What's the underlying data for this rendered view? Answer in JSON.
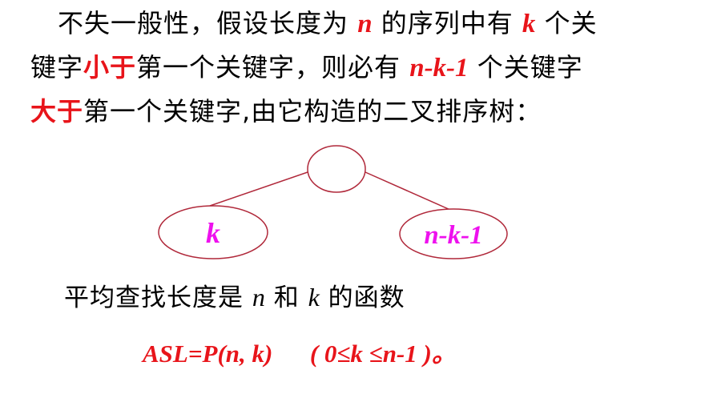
{
  "paragraph": {
    "line1": {
      "t1": "不失一般性，假设长度为 ",
      "n": "n",
      "t2": " 的序列中有 ",
      "k": "k",
      "t3": " 个关"
    },
    "line2": {
      "t1": "键字",
      "em": "小于",
      "t2": "第一个关键字，则必有 ",
      "nk1": "n-k-1",
      "t3": " 个关键字"
    },
    "line3": {
      "em": "大于",
      "t1": "第一个关键字,由它构造的二叉排序树："
    }
  },
  "tree": {
    "root_label": "",
    "left_label": "k",
    "right_label": "n-k-1",
    "line_color": "#b0283a",
    "label_color": "#ee11ee"
  },
  "avg_sentence": {
    "t1": "平均查找长度是 ",
    "n": "n",
    "t2": " 和 ",
    "k": "k",
    "t3": " 的函数"
  },
  "formula": {
    "text": "ASL=P(n, k)      ( 0≤k ≤n-1 )。"
  },
  "colors": {
    "emphasis_red": "#e8141a",
    "tree_label_magenta": "#ee11ee",
    "tree_line": "#b0283a"
  }
}
